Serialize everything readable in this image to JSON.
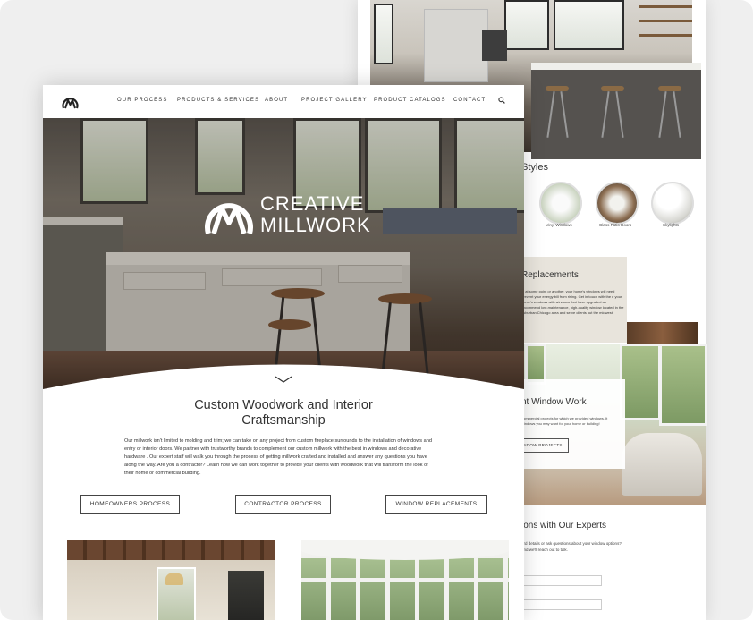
{
  "back_page": {
    "styles_heading": "Styles",
    "styles": [
      {
        "label": "Vinyl Windows"
      },
      {
        "label": "Glass Patio Doors"
      },
      {
        "label": "Skylights"
      }
    ],
    "replacements_heading": "Replacements",
    "replacements_text": "s, at some point or another, your home's windows will need prevent your energy bill from rising. Get in touch with the e your home's windows with windows that have upgraded an recommend low-maintenance, high-quality window located in the suburban Chicago area and serve clients out the midwest",
    "window_work_heading": "nt Window Work",
    "window_work_text": "commercial projects for which we provided windows. It windows you may want for your home or building!",
    "window_work_button": "NDOW PROJECTS",
    "experts_heading": "ions with Our Experts",
    "experts_text": "ard details or ask questions about your window options? and we'll reach out to talk."
  },
  "nav": {
    "items": [
      "OUR PROCESS",
      "PRODUCTS & SERVICES",
      "ABOUT",
      "PROJECT GALLERY",
      "PRODUCT CATALOGS",
      "CONTACT"
    ]
  },
  "hero": {
    "brand_line1": "CREATIVE",
    "brand_line2": "MILLWORK"
  },
  "intro": {
    "title_line1": "Custom Woodwork and Interior",
    "title_line2": "Craftsmanship",
    "body": "Our millwork isn't limited to molding and trim; we can take on any project from custom fireplace surrounds to the installation of windows and entry or interior doors. We partner with trustworthy brands to complement our custom millwork with the best in windows and decorative hardware . Our expert staff will walk you through the process of getting millwork crafted and installed and answer any questions you have along the way. Are you a contractor? Learn how we can work together to provide your clients with woodwork that will transform the look of their home or commercial building."
  },
  "buttons": {
    "homeowners": "HOMEOWNERS PROCESS",
    "contractor": "CONTRACTOR PROCESS",
    "windows": "WINDOW REPLACEMENTS"
  },
  "icons": {
    "logo": "creative-millwork-logo",
    "search": "search-icon",
    "chevron": "chevron-down-icon"
  },
  "colors": {
    "background": "#efefef",
    "text": "#333333",
    "panel_beige": "#e8e4dc"
  }
}
